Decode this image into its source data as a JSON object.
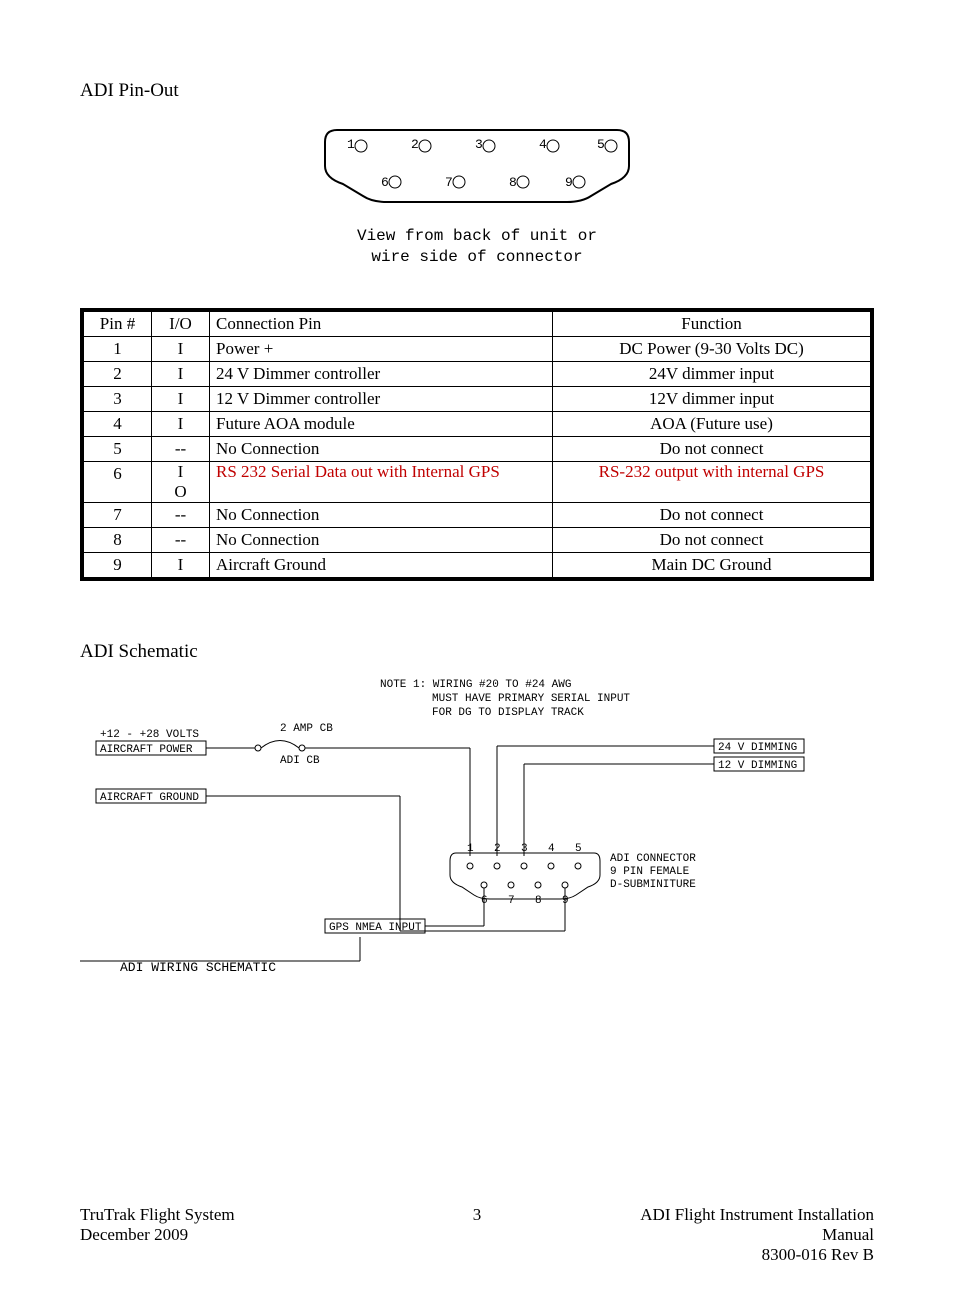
{
  "title": "ADI Pin-Out",
  "connector_caption_line1": "View from back of unit or",
  "connector_caption_line2": "wire side of connector",
  "table": {
    "headers": {
      "pin": "Pin #",
      "io": "I/O",
      "conn": "Connection Pin",
      "func": "Function"
    },
    "rows": [
      {
        "pin": "1",
        "io": "I",
        "conn": "Power +",
        "func": "DC Power (9-30 Volts DC)"
      },
      {
        "pin": "2",
        "io": "I",
        "conn": "24 V Dimmer controller",
        "func": "24V dimmer input"
      },
      {
        "pin": "3",
        "io": "I",
        "conn": "12 V Dimmer controller",
        "func": "12V dimmer input"
      },
      {
        "pin": "4",
        "io": "I",
        "conn": "Future AOA module",
        "func": "AOA (Future use)"
      },
      {
        "pin": "5",
        "io": "--",
        "conn": "No Connection",
        "func": "Do not connect"
      },
      {
        "pin": "6",
        "io_line1": "I",
        "io_line2": "O",
        "conn_line1": "",
        "conn_line2": "RS 232 Serial Data out with Internal GPS",
        "func_line1": "",
        "func_line2": "RS-232 output with internal GPS",
        "red": true
      },
      {
        "pin": "7",
        "io": "--",
        "conn": "No Connection",
        "func": "Do not connect"
      },
      {
        "pin": "8",
        "io": "--",
        "conn": "No Connection",
        "func": "Do not connect"
      },
      {
        "pin": "9",
        "io": "I",
        "conn": "Aircraft Ground",
        "func": "Main DC Ground"
      }
    ]
  },
  "schematic_title": "ADI Schematic",
  "schematic": {
    "note_line1": "NOTE 1:  WIRING #20 TO #24 AWG",
    "note_line2": "MUST HAVE PRIMARY SERIAL INPUT",
    "note_line3": "FOR DG TO DISPLAY TRACK",
    "cb_label": "2 AMP CB",
    "adi_cb": "ADI CB",
    "volts": "+12 - +28 VOLTS",
    "power": "AIRCRAFT POWER",
    "ground": "AIRCRAFT GROUND",
    "dim24": "24 V DIMMING",
    "dim12": "12 V DIMMING",
    "conn_line1": "ADI CONNECTOR",
    "conn_line2": "9 PIN FEMALE",
    "conn_line3": "D-SUBMINITURE",
    "gps": "GPS NMEA INPUT",
    "title": "ADI WIRING SCHEMATIC"
  },
  "footer": {
    "left1": "TruTrak Flight System",
    "left2": "December 2009",
    "center": "3",
    "right1": "ADI Flight Instrument Installation Manual",
    "right2": "8300-016  Rev B"
  }
}
